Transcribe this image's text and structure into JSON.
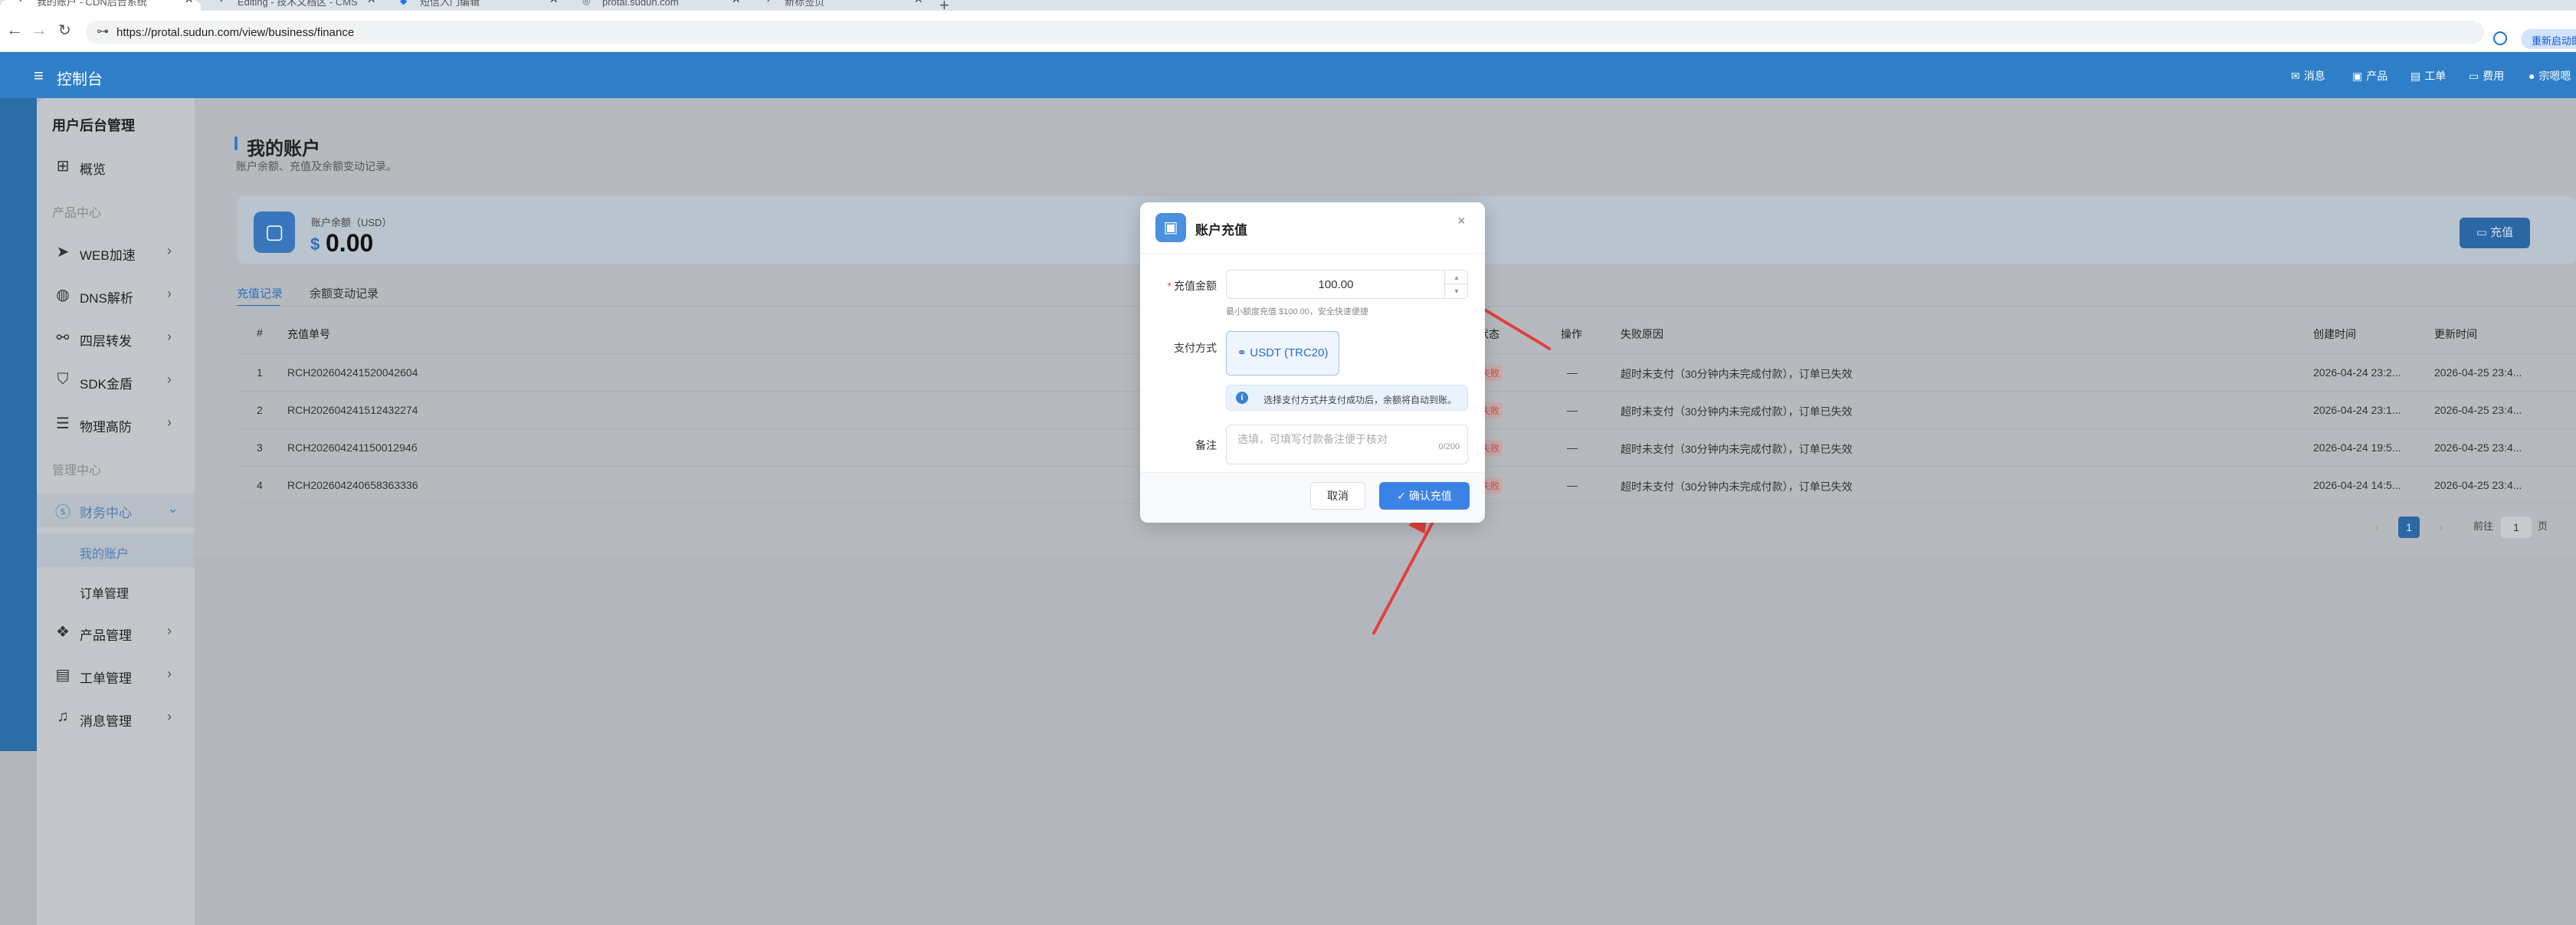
{
  "browser": {
    "tabs": [
      {
        "title": "我的账户 - CDN后台系统"
      },
      {
        "title": "Editing - 技术文档区 - CMS"
      },
      {
        "title": "短信入门编辑"
      },
      {
        "title": "protal.sudun.com"
      },
      {
        "title": "新标签页"
      }
    ],
    "url": "https://protal.sudun.com/view/business/finance",
    "relaunch_label": "重新启动即"
  },
  "header": {
    "title": "控制台",
    "items": [
      {
        "label": "消息",
        "icon": "mail-icon"
      },
      {
        "label": "产品",
        "icon": "box-icon"
      },
      {
        "label": "工单",
        "icon": "ticket-icon"
      },
      {
        "label": "费用",
        "icon": "wallet-icon"
      },
      {
        "label": "宗嗯嗯",
        "icon": "avatar"
      }
    ]
  },
  "sidebar": {
    "title": "用户后台管理",
    "overview": "概览",
    "section_product": "产品中心",
    "items_product": [
      {
        "label": "WEB加速"
      },
      {
        "label": "DNS解析"
      },
      {
        "label": "四层转发"
      },
      {
        "label": "SDK金盾"
      },
      {
        "label": "物理高防"
      }
    ],
    "section_manage": "管理中心",
    "finance": "财务中心",
    "finance_sub": [
      {
        "label": "我的账户"
      },
      {
        "label": "订单管理"
      }
    ],
    "items_manage": [
      {
        "label": "产品管理"
      },
      {
        "label": "工单管理"
      },
      {
        "label": "消息管理"
      }
    ]
  },
  "page": {
    "title": "我的账户",
    "subtitle": "账户余额、充值及余额变动记录。",
    "balance_label": "账户余额（USD）",
    "balance_currency": "$",
    "balance_value": "0.00",
    "recharge_button": "充值",
    "tabs": [
      "充值记录",
      "余额变动记录"
    ]
  },
  "table": {
    "columns": {
      "index": "#",
      "order": "充值单号",
      "status": "状态",
      "action": "操作",
      "reason": "失败原因",
      "created": "创建时间",
      "updated": "更新时间"
    },
    "rows": [
      {
        "index": "1",
        "order": "RCH202604241520042604",
        "status": "失败",
        "action": "—",
        "reason": "超时未支付（30分钟内未完成付款），订单已失效",
        "created": "2026-04-24 23:2...",
        "updated": "2026-04-25 23:4..."
      },
      {
        "index": "2",
        "order": "RCH202604241512432274",
        "status": "失败",
        "action": "—",
        "reason": "超时未支付（30分钟内未完成付款），订单已失效",
        "created": "2026-04-24 23:1...",
        "updated": "2026-04-25 23:4..."
      },
      {
        "index": "3",
        "order": "RCH20260424115001294б",
        "status": "失败",
        "action": "—",
        "reason": "超时未支付（30分钟内未完成付款），订单已失效",
        "created": "2026-04-24 19:5...",
        "updated": "2026-04-25 23:4..."
      },
      {
        "index": "4",
        "order": "RCH202604240658363336",
        "status": "失败",
        "action": "—",
        "reason": "超时未支付（30分钟内未完成付款），订单已失效",
        "created": "2026-04-24 14:5...",
        "updated": "2026-04-25 23:4..."
      }
    ]
  },
  "pagination": {
    "prev": "‹",
    "current": "1",
    "next": "›",
    "goto_label": "前往",
    "goto_value": "1",
    "page_suffix": "页"
  },
  "modal": {
    "title": "账户充值",
    "amount_label": "充值金额",
    "amount_value": "100.00",
    "amount_hint": "最小额度充值 $100.00，安全快速便捷",
    "payment_label": "支付方式",
    "payment_option": "USDT (TRC20)",
    "payment_info": "选择支付方式并支付成功后，余额将自动到账。",
    "remark_label": "备注",
    "remark_placeholder": "选填，可填写付款备注便于核对",
    "remark_count": "0/200",
    "cancel_button": "取消",
    "confirm_button": "确认充值"
  },
  "colors": {
    "brand": "#2e7fc8",
    "annotation_arrow": "#e3403e",
    "confirm": "#3b82e6"
  }
}
